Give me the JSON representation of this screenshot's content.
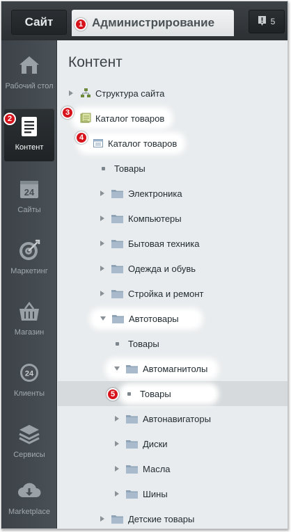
{
  "topbar": {
    "site_label": "Сайт",
    "admin_label": "Администрирование",
    "notify_count": "5"
  },
  "sidebar": {
    "items": [
      {
        "label": "Рабочий стол",
        "icon": "home-icon"
      },
      {
        "label": "Контент",
        "icon": "document-icon"
      },
      {
        "label": "Сайты",
        "icon": "calendar-24-icon"
      },
      {
        "label": "Маркетинг",
        "icon": "target-icon"
      },
      {
        "label": "Магазин",
        "icon": "basket-icon"
      },
      {
        "label": "Клиенты",
        "icon": "clients-24-icon"
      },
      {
        "label": "Сервисы",
        "icon": "layers-icon"
      },
      {
        "label": "Marketplace",
        "icon": "cloud-download-icon"
      }
    ],
    "active_index": 1
  },
  "content": {
    "title": "Контент",
    "tree": [
      {
        "label": "Структура сайта",
        "kind": "site-structure",
        "arrow": "collapsed"
      },
      {
        "label": "Каталог товаров",
        "kind": "catalog",
        "arrow": "none"
      },
      {
        "label": "Каталог товаров",
        "kind": "iblock",
        "arrow": "expanded"
      },
      {
        "label": "Товары",
        "kind": "dot",
        "arrow": "none"
      },
      {
        "label": "Электроника",
        "kind": "folder",
        "arrow": "collapsed"
      },
      {
        "label": "Компьютеры",
        "kind": "folder",
        "arrow": "collapsed"
      },
      {
        "label": "Бытовая техника",
        "kind": "folder",
        "arrow": "collapsed"
      },
      {
        "label": "Одежда и обувь",
        "kind": "folder",
        "arrow": "collapsed"
      },
      {
        "label": "Стройка и ремонт",
        "kind": "folder",
        "arrow": "collapsed"
      },
      {
        "label": "Автотовары",
        "kind": "folder",
        "arrow": "expanded"
      },
      {
        "label": "Товары",
        "kind": "dot",
        "arrow": "none"
      },
      {
        "label": "Автомагнитолы",
        "kind": "folder",
        "arrow": "expanded"
      },
      {
        "label": "Товары",
        "kind": "dot",
        "arrow": "none"
      },
      {
        "label": "Автонавигаторы",
        "kind": "folder",
        "arrow": "collapsed"
      },
      {
        "label": "Диски",
        "kind": "folder",
        "arrow": "collapsed"
      },
      {
        "label": "Масла",
        "kind": "folder",
        "arrow": "collapsed"
      },
      {
        "label": "Шины",
        "kind": "folder",
        "arrow": "collapsed"
      },
      {
        "label": "Детские товары",
        "kind": "folder",
        "arrow": "collapsed"
      }
    ]
  },
  "badges": [
    "1",
    "2",
    "3",
    "4",
    "5"
  ],
  "colors": {
    "badge": "#d7141c",
    "sidebar": "#43494e",
    "folder": "#8fa3b6"
  }
}
